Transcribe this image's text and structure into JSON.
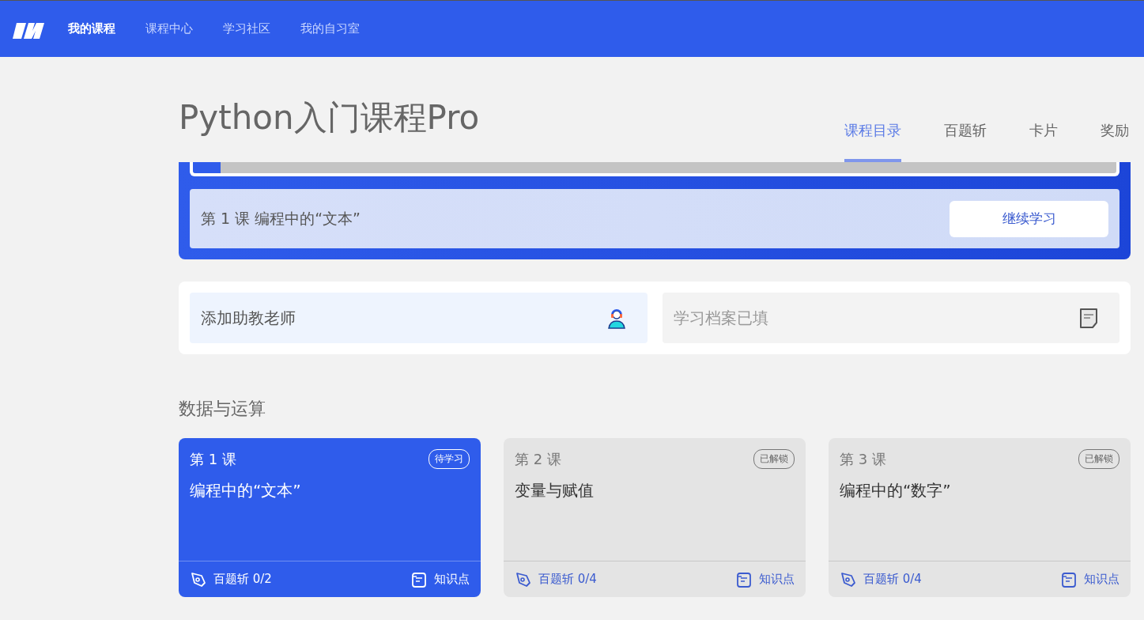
{
  "nav": {
    "items": [
      {
        "label": "我的课程",
        "selected": true
      },
      {
        "label": "课程中心",
        "selected": false
      },
      {
        "label": "学习社区",
        "selected": false
      },
      {
        "label": "我的自习室",
        "selected": false
      }
    ]
  },
  "course": {
    "title": "Python入门课程Pro",
    "tabs": [
      {
        "label": "课程目录",
        "selected": true
      },
      {
        "label": "百题斩",
        "selected": false
      },
      {
        "label": "卡片",
        "selected": false
      },
      {
        "label": "奖励",
        "selected": false
      }
    ]
  },
  "progress": {
    "level": 0.03,
    "current_lesson": "第 1 课 编程中的“文本”",
    "button": "继续学习"
  },
  "shortcuts": [
    {
      "kind": "assistant",
      "label": "添加助教老师"
    },
    {
      "kind": "profile",
      "label": "学习档案已填"
    }
  ],
  "section": {
    "title": "数据与运算",
    "lessons": [
      {
        "number": "第 1 课",
        "title": "编程中的“文本”",
        "status": "待学习",
        "current": true,
        "quiz": "百题斩 0/2",
        "notes": "知识点"
      },
      {
        "number": "第 2 课",
        "title": "变量与赋值",
        "status": "已解锁",
        "current": false,
        "quiz": "百题斩 0/4",
        "notes": "知识点"
      },
      {
        "number": "第 3 课",
        "title": "编程中的“数字”",
        "status": "已解锁",
        "current": false,
        "quiz": "百题斩 0/4",
        "notes": "知识点"
      }
    ]
  }
}
